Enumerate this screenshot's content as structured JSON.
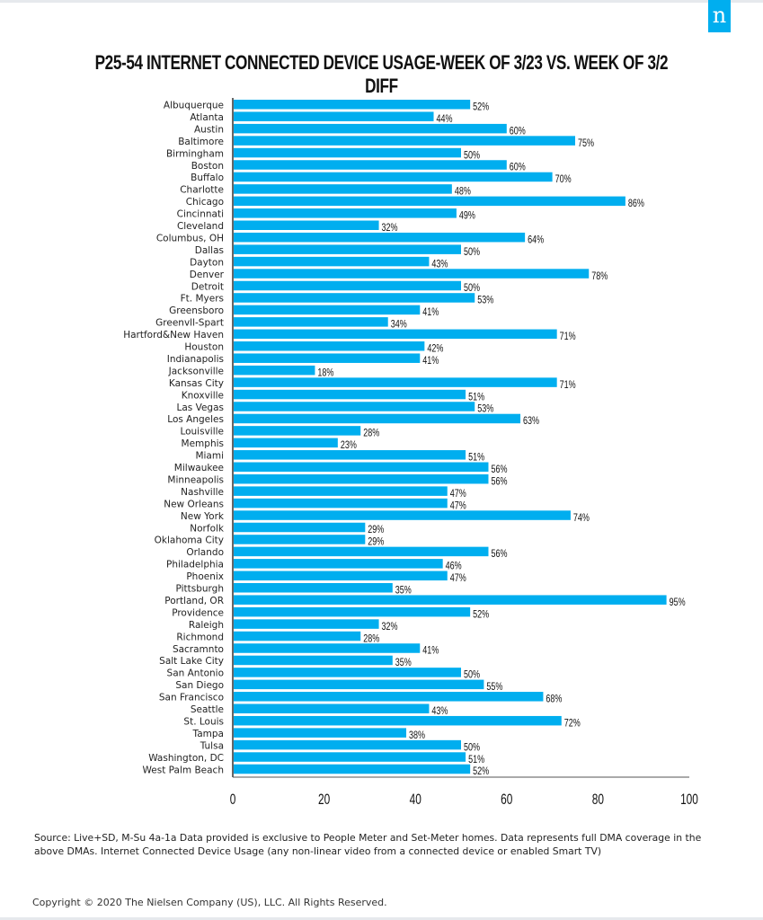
{
  "brand": {
    "logo_letter": "n",
    "accent_color": "#00aeef"
  },
  "title": "P25-54 INTERNET CONNECTED DEVICE USAGE-WEEK OF 3/23 VS. WEEK OF 3/2 DIFF",
  "chart_data": {
    "type": "bar",
    "orientation": "horizontal",
    "title": "P25-54 INTERNET CONNECTED DEVICE USAGE-WEEK OF 3/23 VS. WEEK OF 3/2 DIFF",
    "xlabel": "",
    "ylabel": "",
    "xlim": [
      0,
      100
    ],
    "xticks": [
      "0",
      "20",
      "40",
      "60",
      "80",
      "100"
    ],
    "grid": false,
    "legend": "none",
    "bar_color": "#00aeef",
    "categories": [
      "Albuquerque",
      "Atlanta",
      "Austin",
      "Baltimore",
      "Birmingham",
      "Boston",
      "Buffalo",
      "Charlotte",
      "Chicago",
      "Cincinnati",
      "Cleveland",
      "Columbus, OH",
      "Dallas",
      "Dayton",
      "Denver",
      "Detroit",
      "Ft. Myers",
      "Greensboro",
      "Greenvll-Spart",
      "Hartford&New Haven",
      "Houston",
      "Indianapolis",
      "Jacksonville",
      "Kansas City",
      "Knoxville",
      "Las Vegas",
      "Los Angeles",
      "Louisville",
      "Memphis",
      "Miami",
      "Milwaukee",
      "Minneapolis",
      "Nashville",
      "New Orleans",
      "New York",
      "Norfolk",
      "Oklahoma City",
      "Orlando",
      "Philadelphia",
      "Phoenix",
      "Pittsburgh",
      "Portland, OR",
      "Providence",
      "Raleigh",
      "Richmond",
      "Sacramnto",
      "Salt Lake City",
      "San Antonio",
      "San Diego",
      "San Francisco",
      "Seattle",
      "St. Louis",
      "Tampa",
      "Tulsa",
      "Washington, DC",
      "West Palm Beach"
    ],
    "values": [
      52,
      44,
      60,
      75,
      50,
      60,
      70,
      48,
      86,
      49,
      32,
      64,
      50,
      43,
      78,
      50,
      53,
      41,
      34,
      71,
      42,
      41,
      18,
      71,
      51,
      53,
      63,
      28,
      23,
      51,
      56,
      56,
      47,
      47,
      74,
      29,
      29,
      56,
      46,
      47,
      35,
      95,
      52,
      32,
      28,
      41,
      35,
      50,
      55,
      68,
      43,
      72,
      38,
      50,
      51,
      52
    ],
    "data_labels": [
      "52%",
      "44%",
      "60%",
      "75%",
      "50%",
      "60%",
      "70%",
      "48%",
      "86%",
      "49%",
      "32%",
      "64%",
      "50%",
      "43%",
      "78%",
      "50%",
      "53%",
      "41%",
      "34%",
      "71%",
      "42%",
      "41%",
      "18%",
      "71%",
      "51%",
      "53%",
      "63%",
      "28%",
      "23%",
      "51%",
      "56%",
      "56%",
      "47%",
      "47%",
      "74%",
      "29%",
      "29%",
      "56%",
      "46%",
      "47%",
      "35%",
      "95%",
      "52%",
      "32%",
      "28%",
      "41%",
      "35%",
      "50%",
      "55%",
      "68%",
      "43%",
      "72%",
      "38%",
      "50%",
      "51%",
      "52%"
    ]
  },
  "footer": {
    "source": "Source: Live+SD, M-Su 4a-1a Data provided is exclusive to People Meter and Set-Meter homes. Data represents full DMA coverage in the above DMAs. Internet Connected Device Usage (any non-linear video from a connected device or enabled Smart TV)",
    "copyright": "Copyright © 2020 The Nielsen Company (US), LLC. All Rights Reserved."
  }
}
